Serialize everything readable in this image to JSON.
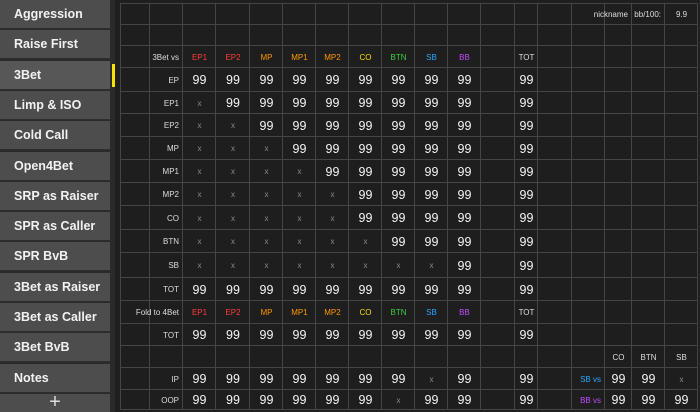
{
  "sidebar": {
    "items": [
      {
        "label": "Aggression",
        "name": "aggression"
      },
      {
        "label": "Raise First",
        "name": "raise-first"
      },
      {
        "label": "3Bet",
        "name": "3bet"
      },
      {
        "label": "Limp & ISO",
        "name": "limp-iso"
      },
      {
        "label": "Cold Call",
        "name": "cold-call"
      },
      {
        "label": "Open4Bet",
        "name": "open4bet"
      },
      {
        "label": "SRP as Raiser",
        "name": "srp-as-raiser"
      },
      {
        "label": "SPR as Caller",
        "name": "spr-as-caller"
      },
      {
        "label": "SPR BvB",
        "name": "spr-bvb"
      },
      {
        "label": "3Bet as Raiser",
        "name": "3bet-as-raiser"
      },
      {
        "label": "3Bet as Caller",
        "name": "3bet-as-caller"
      },
      {
        "label": "3Bet BvB",
        "name": "3bet-bvb"
      },
      {
        "label": "Notes",
        "name": "notes"
      }
    ],
    "active_index": 2,
    "add_label": "+",
    "indicator_color": "#f3e500"
  },
  "header": {
    "nickname_label": "nickname",
    "bb_label": "bb/100:",
    "bb_value": "9.9"
  },
  "positions": [
    "EP1",
    "EP2",
    "MP",
    "MP1",
    "MP2",
    "CO",
    "BTN",
    "SB",
    "BB"
  ],
  "position_colors": {
    "EP1": "#ff3b3b",
    "EP2": "#ff3b3b",
    "MP": "#ff9800",
    "MP1": "#ff9800",
    "MP2": "#ff9800",
    "CO": "#f5e000",
    "BTN": "#3ecf3e",
    "SB": "#2aa7ff",
    "BB": "#c04dff"
  },
  "threebet": {
    "title": "3Bet vs",
    "total_label": "TOT",
    "rows": [
      {
        "label": "EP",
        "cells": [
          "99",
          "99",
          "99",
          "99",
          "99",
          "99",
          "99",
          "99",
          "99"
        ],
        "total": "99"
      },
      {
        "label": "EP1",
        "cells": [
          "x",
          "99",
          "99",
          "99",
          "99",
          "99",
          "99",
          "99",
          "99"
        ],
        "total": "99"
      },
      {
        "label": "EP2",
        "cells": [
          "x",
          "x",
          "99",
          "99",
          "99",
          "99",
          "99",
          "99",
          "99"
        ],
        "total": "99"
      },
      {
        "label": "MP",
        "cells": [
          "x",
          "x",
          "x",
          "99",
          "99",
          "99",
          "99",
          "99",
          "99"
        ],
        "total": "99"
      },
      {
        "label": "MP1",
        "cells": [
          "x",
          "x",
          "x",
          "x",
          "99",
          "99",
          "99",
          "99",
          "99"
        ],
        "total": "99"
      },
      {
        "label": "MP2",
        "cells": [
          "x",
          "x",
          "x",
          "x",
          "x",
          "99",
          "99",
          "99",
          "99"
        ],
        "total": "99"
      },
      {
        "label": "CO",
        "cells": [
          "x",
          "x",
          "x",
          "x",
          "x",
          "99",
          "99",
          "99",
          "99"
        ],
        "total": "99"
      },
      {
        "label": "BTN",
        "cells": [
          "x",
          "x",
          "x",
          "x",
          "x",
          "x",
          "99",
          "99",
          "99"
        ],
        "total": "99"
      },
      {
        "label": "SB",
        "cells": [
          "x",
          "x",
          "x",
          "x",
          "x",
          "x",
          "x",
          "x",
          "99"
        ],
        "total": "99"
      },
      {
        "label": "TOT",
        "cells": [
          "99",
          "99",
          "99",
          "99",
          "99",
          "99",
          "99",
          "99",
          "99"
        ],
        "total": "99"
      }
    ]
  },
  "fold4bet": {
    "title": "Fold to 4Bet",
    "total_label": "TOT",
    "rows": [
      {
        "label": "TOT",
        "cells": [
          "99",
          "99",
          "99",
          "99",
          "99",
          "99",
          "99",
          "99",
          "99"
        ],
        "total": "99"
      },
      {
        "label": "IP",
        "cells": [
          "99",
          "99",
          "99",
          "99",
          "99",
          "99",
          "99",
          "x",
          "99"
        ],
        "total": "99"
      },
      {
        "label": "OOP",
        "cells": [
          "99",
          "99",
          "99",
          "99",
          "99",
          "99",
          "x",
          "99",
          "99"
        ],
        "total": "99"
      }
    ]
  },
  "side_panel": {
    "headers": [
      "CO",
      "BTN",
      "SB"
    ],
    "rows": [
      {
        "label": "SB vs",
        "label_color": "#2aa7ff",
        "cells": [
          "99",
          "99",
          "x"
        ]
      },
      {
        "label": "BB vs",
        "label_color": "#c04dff",
        "cells": [
          "99",
          "99",
          "99"
        ]
      }
    ]
  }
}
